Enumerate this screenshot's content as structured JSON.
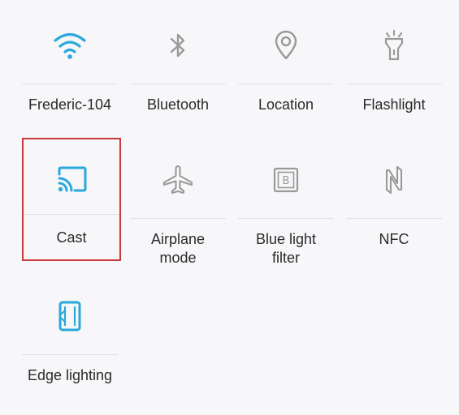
{
  "quick_settings": {
    "tiles": [
      {
        "label": "Frederic-104",
        "icon": "wifi-icon",
        "active": true
      },
      {
        "label": "Bluetooth",
        "icon": "bluetooth-icon",
        "active": false
      },
      {
        "label": "Location",
        "icon": "location-pin-icon",
        "active": false
      },
      {
        "label": "Flashlight",
        "icon": "flashlight-icon",
        "active": false
      },
      {
        "label": "Cast",
        "icon": "cast-icon",
        "active": true,
        "highlighted": true
      },
      {
        "label": "Airplane mode",
        "icon": "airplane-icon",
        "active": false
      },
      {
        "label": "Blue light filter",
        "icon": "blue-light-filter-icon",
        "active": false
      },
      {
        "label": "NFC",
        "icon": "nfc-icon",
        "active": false
      },
      {
        "label": "Edge lighting",
        "icon": "edge-lighting-icon",
        "active": true
      }
    ]
  },
  "colors": {
    "background": "#f7f6f9",
    "active_icon": "#29a8dc",
    "inactive_icon": "#9a9a9a",
    "label_text": "#2b2b2b",
    "highlight_border": "#c9383c"
  }
}
